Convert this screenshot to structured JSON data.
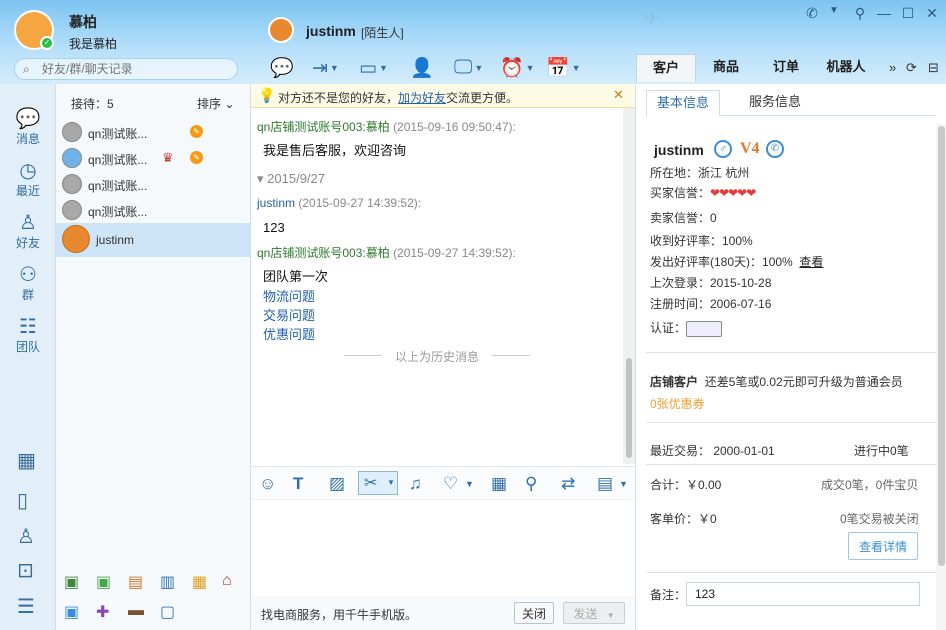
{
  "user": {
    "name": "慕柏",
    "signature": "我是慕柏"
  },
  "search": {
    "placeholder": "好友/群/聊天记录"
  },
  "chat_header": {
    "name": "justinm",
    "tag": "[陌生人]"
  },
  "right_tabs": [
    "客户",
    "商品",
    "订单",
    "机器人"
  ],
  "nav": [
    {
      "label": "消息",
      "icon": "message-icon"
    },
    {
      "label": "最近",
      "icon": "clock-icon"
    },
    {
      "label": "好友",
      "icon": "person-icon"
    },
    {
      "label": "群",
      "icon": "group-icon"
    },
    {
      "label": "团队",
      "icon": "team-icon"
    }
  ],
  "contact_list": {
    "reception": "接待：5",
    "sort": "排序",
    "items": [
      {
        "name": "qn测试账..."
      },
      {
        "name": "qn测试账..."
      },
      {
        "name": "qn测试账..."
      },
      {
        "name": "qn测试账..."
      },
      {
        "name": "justinm"
      }
    ]
  },
  "notice": {
    "text": "对方还不是您的好友，",
    "link": "加为好友",
    "tail": "交流更方便。"
  },
  "messages": {
    "m1_sender": "qn店铺测试账号003:慕柏",
    "m1_time": "(2015-09-16 09:50:47):",
    "m1_text": "我是售后客服，欢迎咨询",
    "date_sep": "2015/9/27",
    "m2_sender": "justinm",
    "m2_time": "(2015-09-27 14:39:52):",
    "m2_text": "123",
    "m3_sender": "qn店铺测试账号003:慕柏",
    "m3_time": "(2015-09-27 14:39:52):",
    "m3_text": "团队第一次",
    "m3_links": [
      "物流问题",
      "交易问题",
      "优惠问题"
    ],
    "history": "以上为历史消息"
  },
  "footer": {
    "promo": "找电商服务，用千牛手机版。",
    "close": "关闭",
    "send": "发送"
  },
  "customer": {
    "tabs": [
      "基本信息",
      "服务信息"
    ],
    "name": "justinm",
    "vip": "V4",
    "location": "所在地：浙江 杭州",
    "buyer_credit": "买家信誉：",
    "seller_credit": "卖家信誉：0",
    "good_rate": "收到好评率：100%",
    "sent_good_rate": "发出好评率(180天)：100%",
    "view": "查看",
    "last_login": "上次登录：2015-10-28",
    "register": "注册时间：2006-07-16",
    "auth": "认证：",
    "shop_title": "店铺客户",
    "shop_desc": "还差5笔或0.02元即可升级为普通会员",
    "coupon": "0张优惠券",
    "recent_trade": "最近交易：  2000-01-01",
    "in_progress": "进行中0笔",
    "total": "合计：￥0.00",
    "deal": "成交0笔，0件宝贝",
    "unit_price": "客单价：￥0",
    "closed": "0笔交易被关闭",
    "detail_btn": "查看详情",
    "remark_label": "备注：",
    "remark_value": "123"
  }
}
